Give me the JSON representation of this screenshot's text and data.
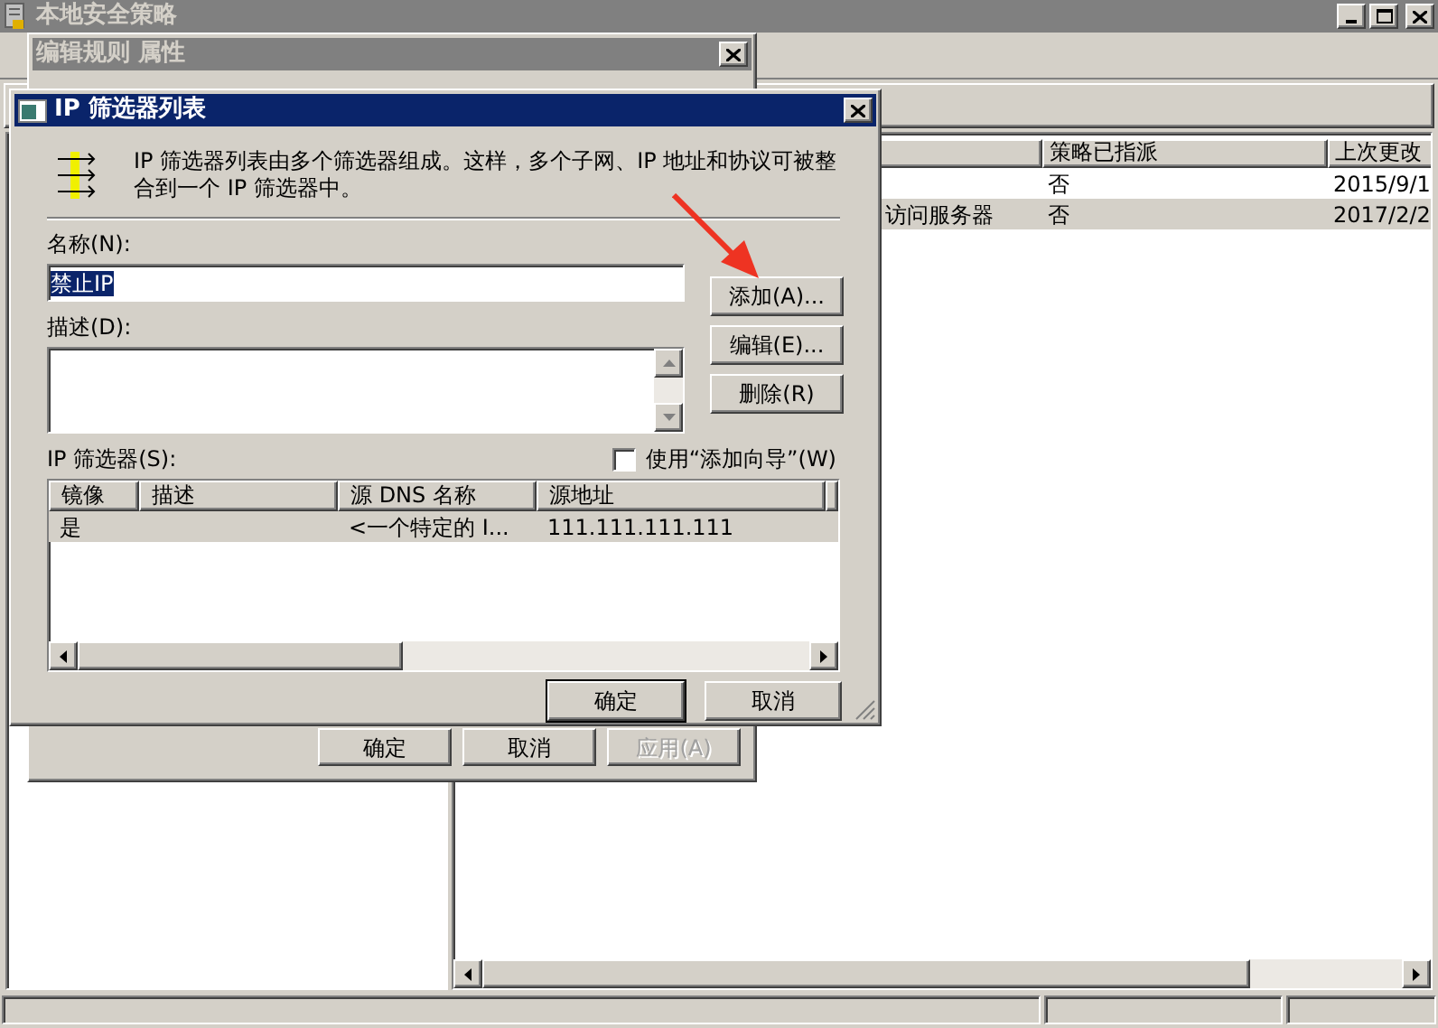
{
  "main_window": {
    "title": "本地安全策略",
    "list": {
      "columns": [
        "策略已指派",
        "上次更改"
      ],
      "rows": [
        {
          "policy_assigned": "否",
          "last_changed": "2015/9/1",
          "selected": false
        },
        {
          "column_1": "访问服务器",
          "policy_assigned": "否",
          "last_changed": "2017/2/2",
          "selected": true
        }
      ]
    }
  },
  "properties_dialog": {
    "title": "编辑规则 属性",
    "active": false,
    "buttons": [
      {
        "label": "确定",
        "disabled": false
      },
      {
        "label": "取消",
        "disabled": false
      },
      {
        "label": "应用(A)",
        "disabled": true
      }
    ]
  },
  "filter_list_dialog": {
    "title": "IP 筛选器列表",
    "active": true,
    "description": "IP 筛选器列表由多个筛选器组成。这样，多个子网、IP 地址和协议可被整合到一个 IP 筛选器中。",
    "name_label": "名称(N):",
    "name_value": "禁止IP",
    "description_label": "描述(D):",
    "side_buttons": [
      "添加(A)...",
      "编辑(E)...",
      "删除(R)"
    ],
    "filters_label": "IP 筛选器(S):",
    "wizard": {
      "label": "使用“添加向导”(W)",
      "checked": false
    },
    "table": {
      "columns": [
        "镜像",
        "描述",
        "源 DNS 名称",
        "源地址"
      ],
      "rows": [
        {
          "mirrored": "是",
          "source_dns_name": "<一个特定的 I...",
          "source_address": "111.111.111.111",
          "selected": true
        }
      ]
    },
    "buttons": [
      {
        "label": "确定",
        "default": true
      },
      {
        "label": "取消",
        "default": false
      }
    ]
  }
}
